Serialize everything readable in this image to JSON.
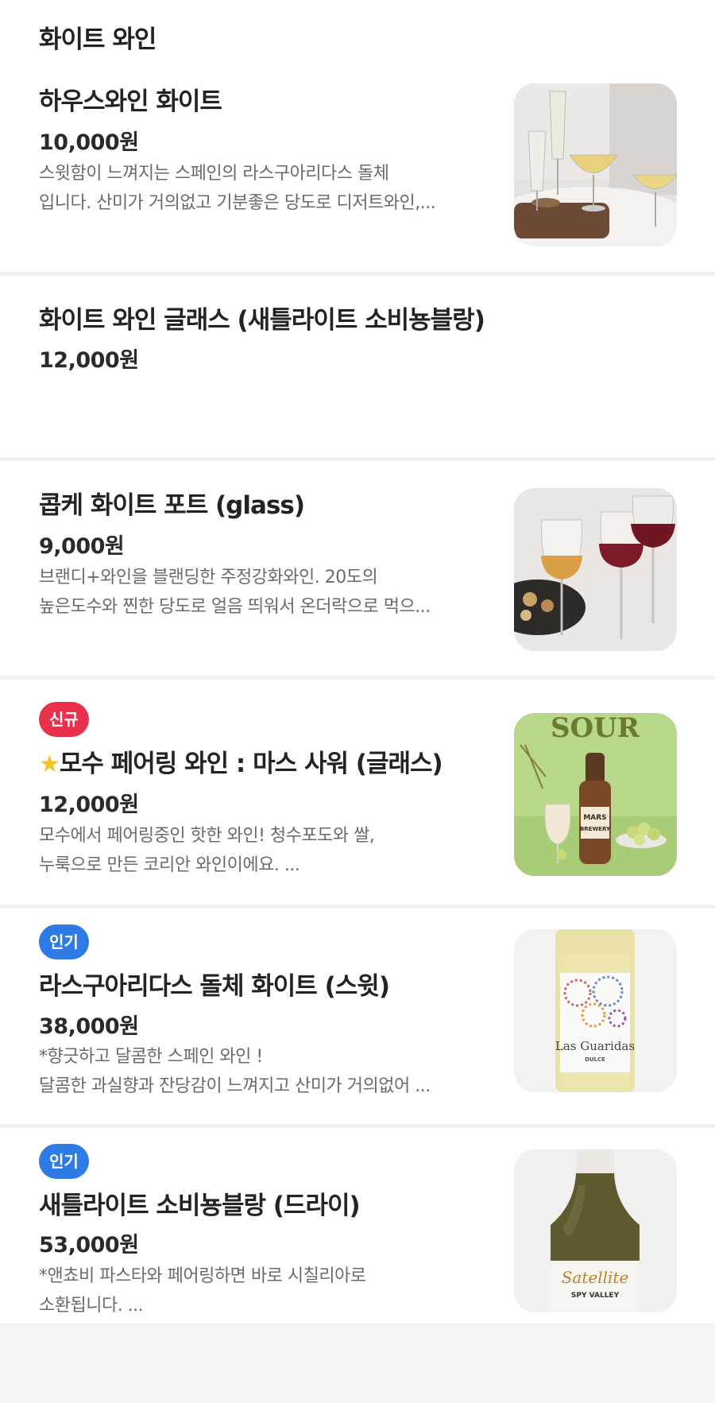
{
  "section": {
    "title": "화이트 와인"
  },
  "items": [
    {
      "name": "하우스와인 화이트",
      "price": "10,000원",
      "desc1": "스윗함이 느껴지는 스페인의 라스구아리다스 돌체",
      "desc2": "입니다. 산미가 거의없고 기분좋은 당도로 디저트와인,..."
    },
    {
      "name": "화이트 와인 글래스 (새틀라이트 소비뇽블랑)",
      "price": "12,000원"
    },
    {
      "name": "콥케 화이트 포트 (glass)",
      "price": "9,000원",
      "desc1": "브랜디+와인을 블랜딩한 주정강화와인. 20도의",
      "desc2": "높은도수와 찐한 당도로 얼음 띄워서 온더락으로 먹으..."
    },
    {
      "badge": "신규",
      "name": "모수 페어링 와인 : 마스 사워 (글래스)",
      "price": "12,000원",
      "desc1": "모수에서 페어링중인 핫한 와인! 청수포도와 쌀,",
      "desc2": "누룩으로 만든 코리안 와인이에요. ...",
      "image_text": {
        "sour": "SOUR",
        "mars": "MARS",
        "brewery": "BREWERY"
      }
    },
    {
      "badge": "인기",
      "name": "라스구아리다스 돌체 화이트 (스윗)",
      "price": "38,000원",
      "desc1": "*향긋하고 달콤한 스페인 와인 !",
      "desc2": "달콤한 과실향과 잔당감이 느껴지고 산미가 거의없어 ...",
      "image_text": {
        "label": "Las Guaridas",
        "sub": "DULCE"
      }
    },
    {
      "badge": "인기",
      "name": "새틀라이트 소비뇽블랑 (드라이)",
      "price": "53,000원",
      "desc1": "*앤쵸비 파스타와 페어링하면 바로 시칠리아로",
      "desc2": "소환됩니다. ...",
      "image_text": {
        "label": "Satellite",
        "sub": "SPY VALLEY"
      }
    }
  ],
  "colors": {
    "badge_new": "#e8314d",
    "badge_hot": "#2f7be6",
    "star": "#f6c12a"
  }
}
